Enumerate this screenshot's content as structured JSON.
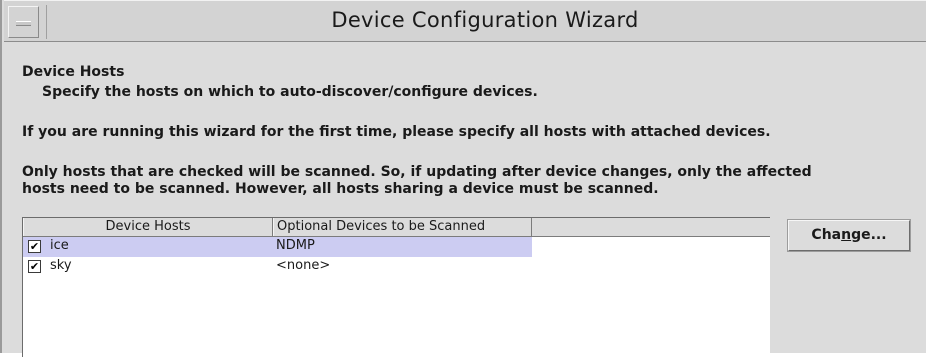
{
  "window": {
    "title": "Device Configuration Wizard",
    "menu_icon": "window-menu-icon"
  },
  "content": {
    "heading": "Device Hosts",
    "subheading": "Specify the hosts on which to auto-discover/configure devices.",
    "para1": "If you are running this wizard for the first time, please specify all hosts with attached devices.",
    "para2_line1": "Only hosts that are checked will be scanned.  So, if updating after device changes, only the affected",
    "para2_line2": "hosts need to be scanned.  However, all hosts sharing a device must be scanned."
  },
  "table": {
    "columns": [
      "Device Hosts",
      "Optional Devices to be Scanned"
    ],
    "rows": [
      {
        "checked": true,
        "host": "ice",
        "devices": "NDMP",
        "selected": true
      },
      {
        "checked": true,
        "host": "sky",
        "devices": "<none>",
        "selected": false
      }
    ],
    "check_glyph": "✔"
  },
  "buttons": {
    "change_pre": "Cha",
    "change_mnemonic": "n",
    "change_post": "ge..."
  },
  "colors": {
    "selection": "#ccccf2",
    "background": "#dcdcdc"
  }
}
